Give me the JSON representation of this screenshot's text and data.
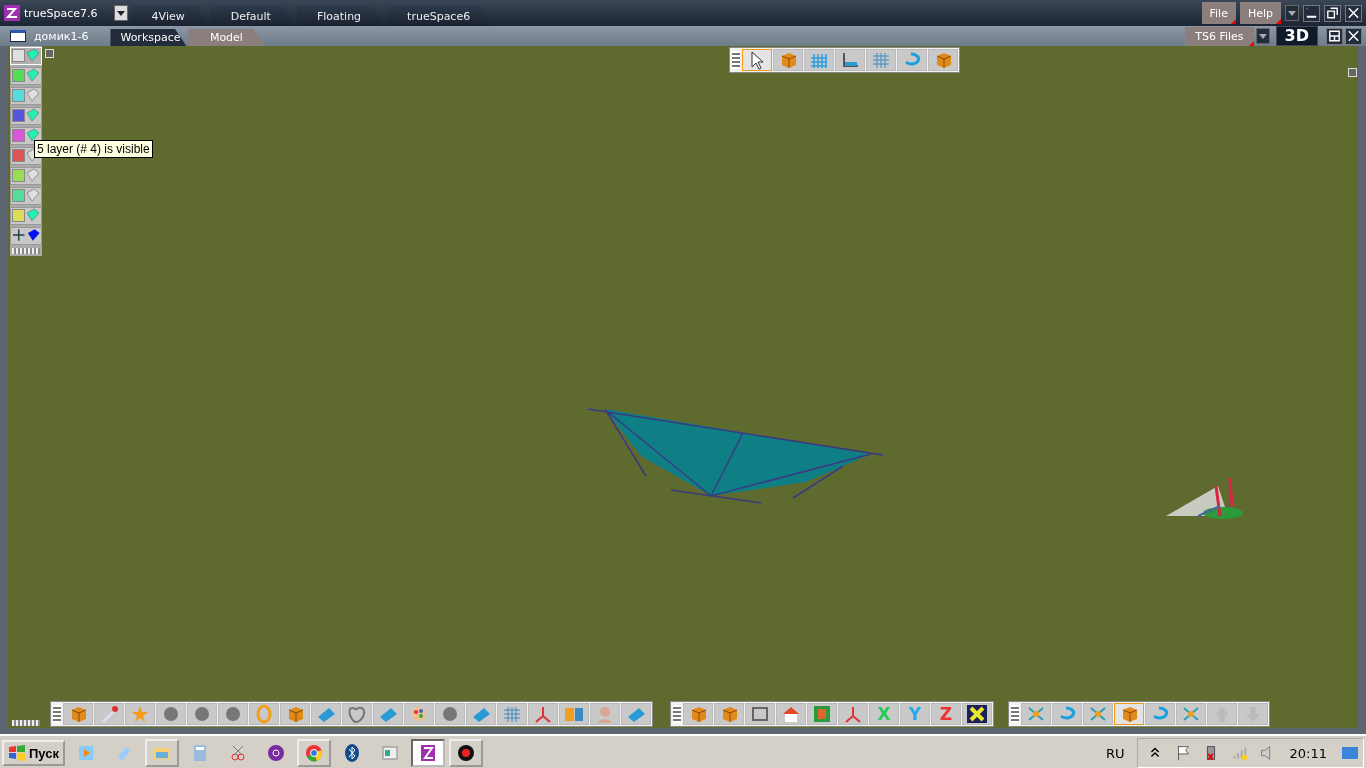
{
  "title_bar": {
    "app_title": "trueSpace7.6",
    "layout_tabs": [
      {
        "label": "4View",
        "selected": false
      },
      {
        "label": "Default",
        "selected": false
      },
      {
        "label": "Floating",
        "selected": false
      },
      {
        "label": "trueSpace6",
        "selected": false
      }
    ],
    "menus": [
      "File",
      "Help"
    ]
  },
  "doc_bar": {
    "doc_title": "домик1-6",
    "view_tabs": [
      {
        "label": "Workspace",
        "selected": true
      },
      {
        "label": "Model",
        "selected": false
      }
    ],
    "library": "TS6 Files",
    "view_mode": "3D"
  },
  "layers": [
    {
      "color": "#e0e0e0",
      "visible": true,
      "selected": true
    },
    {
      "color": "#55dd55",
      "visible": true,
      "selected": false
    },
    {
      "color": "#55dddd",
      "visible": false,
      "selected": false
    },
    {
      "color": "#5555dd",
      "visible": true,
      "selected": false
    },
    {
      "color": "#dd55dd",
      "visible": true,
      "selected": false
    },
    {
      "color": "#dd5555",
      "visible": false,
      "selected": false
    },
    {
      "color": "#99dd55",
      "visible": false,
      "selected": false
    },
    {
      "color": "#55dd99",
      "visible": false,
      "selected": false
    },
    {
      "color": "#dddd55",
      "visible": true,
      "selected": false
    }
  ],
  "tooltip": "5 layer (# 4) is visible",
  "top_toolbar": [
    {
      "selected": true
    },
    {
      "selected": false
    },
    {
      "selected": false
    },
    {
      "selected": false
    },
    {
      "selected": false
    },
    {
      "selected": false
    },
    {
      "selected": false
    }
  ],
  "bottom_toolbars": [
    [
      {
        "selected": false
      },
      {
        "selected": false
      },
      {
        "selected": false
      },
      {
        "selected": false
      },
      {
        "selected": false
      },
      {
        "selected": false
      },
      {
        "selected": false
      },
      {
        "selected": false
      },
      {
        "selected": false
      },
      {
        "selected": false
      },
      {
        "selected": false
      },
      {
        "selected": false
      },
      {
        "selected": false
      },
      {
        "selected": false
      },
      {
        "selected": false
      },
      {
        "selected": false
      },
      {
        "selected": false
      },
      {
        "selected": false
      },
      {
        "selected": false
      }
    ],
    [
      {
        "selected": false
      },
      {
        "selected": false
      },
      {
        "selected": false
      },
      {
        "selected": false
      },
      {
        "selected": false
      },
      {
        "selected": false
      },
      {
        "selected": false,
        "label": "X"
      },
      {
        "selected": false,
        "label": "Y"
      },
      {
        "selected": false,
        "label": "Z"
      },
      {
        "selected": false
      }
    ],
    [
      {
        "selected": false
      },
      {
        "selected": false
      },
      {
        "selected": false
      },
      {
        "selected": true
      },
      {
        "selected": false
      },
      {
        "selected": false
      },
      {
        "selected": false
      },
      {
        "selected": false
      }
    ]
  ],
  "taskbar": {
    "start": "Пуск",
    "apps": [
      {
        "active": false,
        "open": false
      },
      {
        "active": false,
        "open": false
      },
      {
        "active": false,
        "open": true
      },
      {
        "active": false,
        "open": false
      },
      {
        "active": false,
        "open": false
      },
      {
        "active": false,
        "open": false
      },
      {
        "active": false,
        "open": true
      },
      {
        "active": false,
        "open": false
      },
      {
        "active": false,
        "open": false
      },
      {
        "active": true,
        "open": true
      },
      {
        "active": false,
        "open": true
      }
    ],
    "language": "RU",
    "clock": "20:11"
  }
}
